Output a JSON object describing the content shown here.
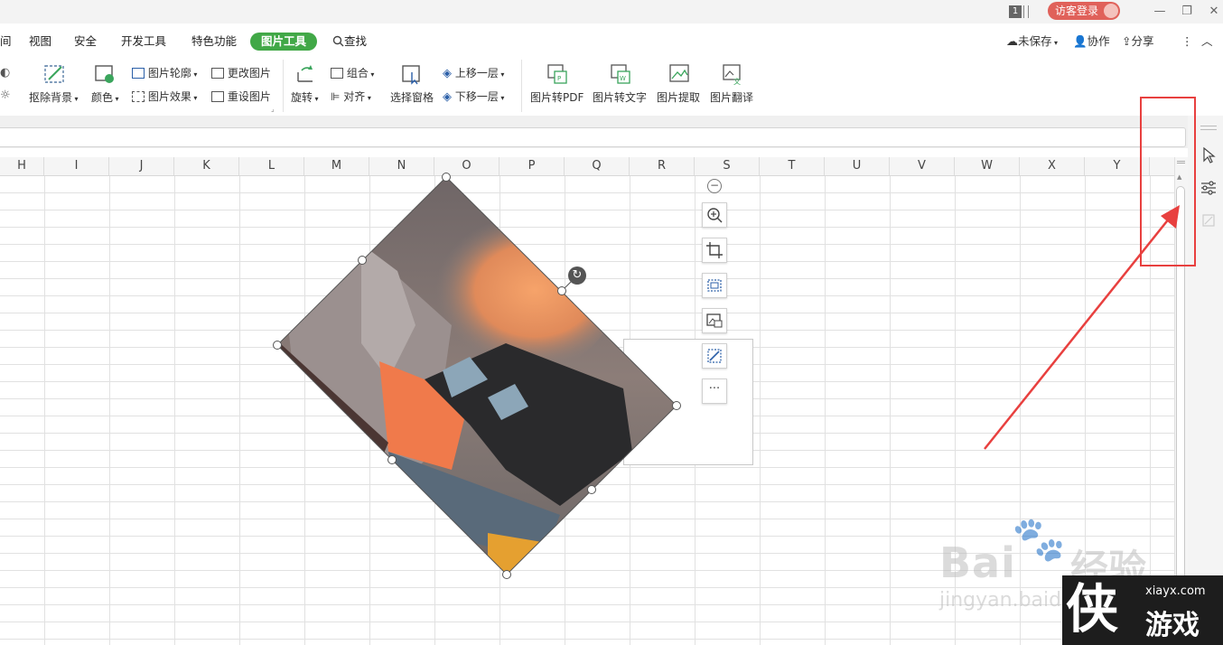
{
  "titlebar": {
    "window_count": "1",
    "guest_login": "访客登录",
    "minimize": "—",
    "restore": "❐",
    "close": "✕"
  },
  "menu": {
    "tabs": [
      "间",
      "视图",
      "安全",
      "开发工具",
      "特色功能",
      "图片工具"
    ],
    "search": "查找",
    "unsaved": "未保存",
    "collab": "协作",
    "share": "分享",
    "more": "⋮",
    "collapse": "︿"
  },
  "ribbon": {
    "remove_bg": "抠除背景",
    "color": "颜色",
    "outline": "图片轮廓",
    "effect": "图片效果",
    "change_pic": "更改图片",
    "reset_pic": "重设图片",
    "rotate": "旋转",
    "group": "组合",
    "align": "对齐",
    "selection_pane": "选择窗格",
    "bring_forward": "上移一层",
    "send_backward": "下移一层",
    "pic_to_pdf": "图片转PDF",
    "pic_to_text": "图片转文字",
    "pic_extract": "图片提取",
    "pic_translate": "图片翻译"
  },
  "columns": [
    "H",
    "I",
    "J",
    "K",
    "L",
    "M",
    "N",
    "O",
    "P",
    "Q",
    "R",
    "S",
    "T",
    "U",
    "V",
    "W",
    "X",
    "Y"
  ],
  "float_toolbar": {
    "collapse": "−",
    "more": "···"
  },
  "watermark": {
    "brand": "Bai",
    "brand_cn": "经验",
    "url": "jingyan.baidu.com",
    "site": "xiayx.com",
    "site_cn": "游戏",
    "site_glyph": "侠"
  },
  "annotation_color": "#e8403f",
  "accent_green": "#41a847"
}
